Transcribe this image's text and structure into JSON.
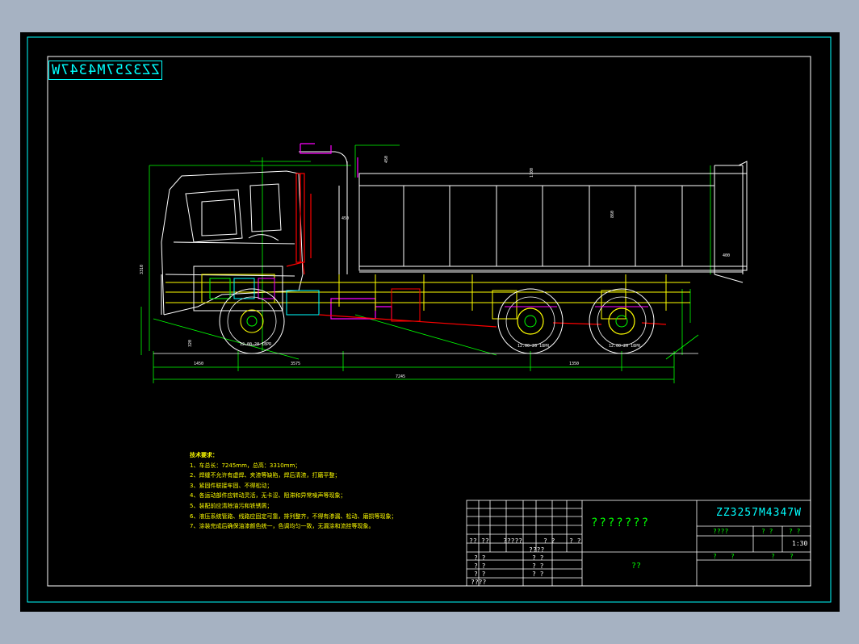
{
  "drawing": {
    "mirrored_code": "ZZ3257M4347W",
    "notes_title": "技术要求：",
    "notes": [
      "1、车总长：7245mm，总高：3310mm；",
      "2、焊缝不允许有虚焊、夹渣等缺陷，焊后清渣，打磨平整；",
      "3、紧固件联接牢固、不得松动；",
      "4、各运动部件应转动灵活，无卡涩、阻滞和异常噪声等现象；",
      "5、装配前应清除油污和铁锈屑；",
      "6、液压系统管路、线路应固定可靠，排列整齐，不得有渗漏、松动、磨损等现象；",
      "7、涂装完成后确保油漆颜色统一，色调均匀一致，无漏涂和流挂等现象。"
    ],
    "tire_labels": [
      "12.00-20 18PR",
      "12.00-20 18PR",
      "12.00-20 18PR"
    ],
    "dims": {
      "cab_height": "3310",
      "front_overhang": "1450",
      "wheelbase_1": "3575",
      "wheelbase_2": "1350",
      "overall_length": "7245",
      "box_height": "1100",
      "box_inner": "860",
      "top_clear": "450",
      "side": "450",
      "rear": "400",
      "front_dim": "400",
      "approach": "320"
    }
  },
  "title_block": {
    "name_cn": "???????",
    "drawing_code": "ZZ3257M4347W",
    "company": "??",
    "scale_label": "????",
    "sheet_a": "? ?",
    "sheet_b": "? ?",
    "ratio": "1:30",
    "row_bottom": [
      "?",
      "?",
      "?",
      "?"
    ],
    "left_rows": [
      [
        "??",
        "??",
        "?????",
        "? ?",
        "? ?"
      ],
      [
        "? ?",
        "",
        "",
        "????",
        ""
      ],
      [
        "? ?",
        "",
        "",
        "? ?",
        ""
      ],
      [
        "? ?",
        "",
        "",
        "? ?",
        ""
      ],
      [
        "????",
        "",
        "",
        "? ?",
        ""
      ]
    ]
  }
}
